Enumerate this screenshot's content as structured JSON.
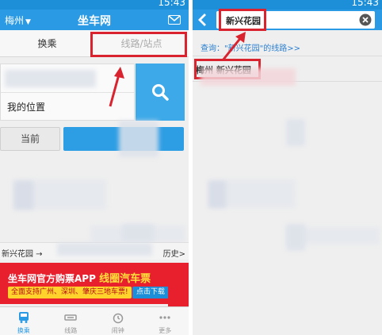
{
  "left": {
    "status": {
      "time": "15:43"
    },
    "header": {
      "city": "梅州",
      "title": "坐车网"
    },
    "tabs": [
      "换乘",
      "线路/站点"
    ],
    "search": {
      "to_value": "我的位置"
    },
    "buttons": {
      "now": "当前"
    },
    "history": {
      "from": "新兴花园 →",
      "label": "历史>"
    },
    "ad": {
      "line1_part1": "坐车网官方购票APP",
      "line1_part2": "线圈汽车票",
      "line2": "全面支持广州、深圳、肇庆三地车票!",
      "download": "点击下载"
    },
    "bottom_nav": [
      "换乘",
      "线路",
      "闹钟",
      "更多"
    ],
    "colors": {
      "header": "#2a9ae4",
      "accent": "#d9232e",
      "ad": "#e8202e"
    }
  },
  "right": {
    "status": {
      "time": "15:43"
    },
    "search": {
      "value": "新兴花园"
    },
    "query": "查询：\"新兴花园\"的线路>>",
    "result": "梅州 新兴花园"
  }
}
